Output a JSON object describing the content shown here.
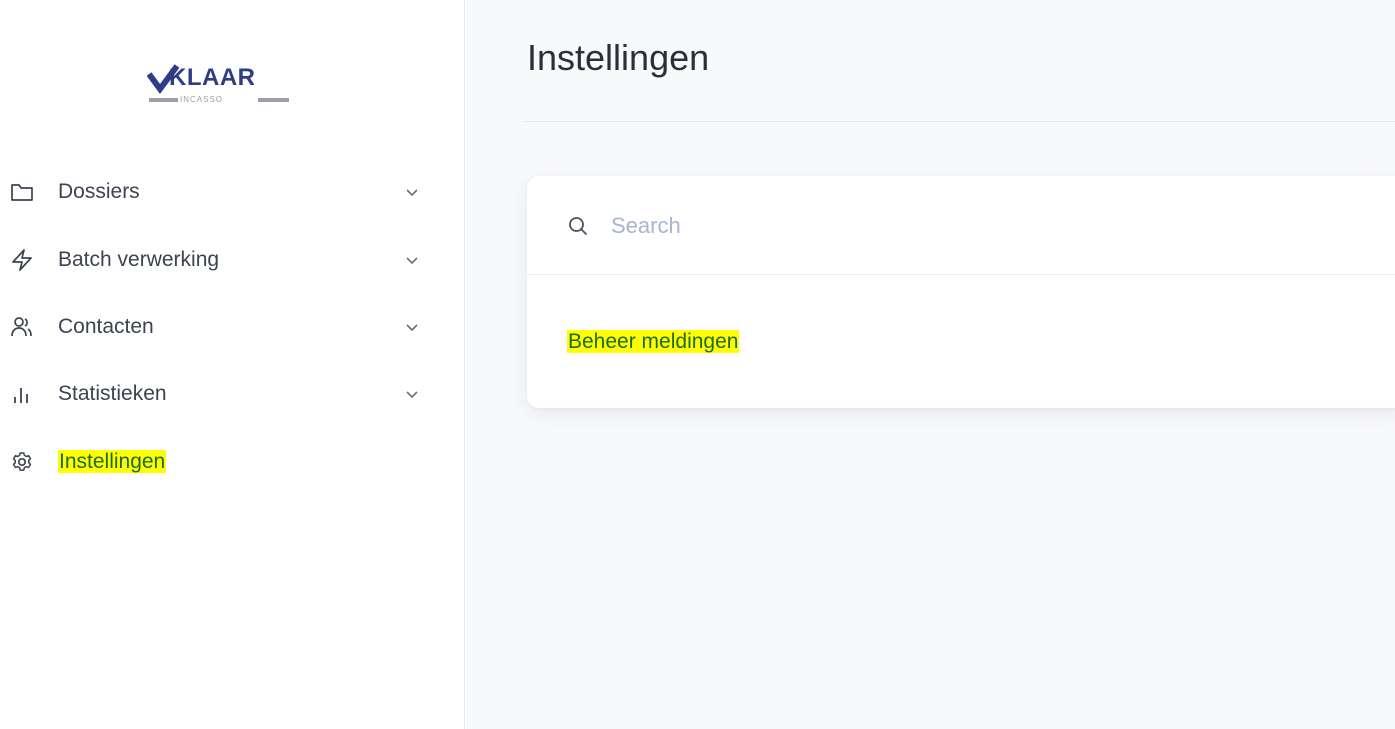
{
  "brand": {
    "name": "KLAAR",
    "sub": "INCASSO"
  },
  "sidebar": {
    "items": [
      {
        "label": "Dossiers",
        "icon": "folder-icon"
      },
      {
        "label": "Batch verwerking",
        "icon": "lightning-icon"
      },
      {
        "label": "Contacten",
        "icon": "users-icon"
      },
      {
        "label": "Statistieken",
        "icon": "bar-chart-icon"
      },
      {
        "label": "Instellingen",
        "icon": "gear-icon",
        "active": true
      }
    ]
  },
  "main": {
    "title": "Instellingen",
    "search": {
      "placeholder": "Search",
      "value": ""
    },
    "links": [
      {
        "label": "Beheer meldingen"
      }
    ]
  },
  "colors": {
    "brand": "#2d3e86",
    "highlight": "#ffff00",
    "highlight_text": "#1d6b2c",
    "placeholder": "#a9b4d3"
  }
}
